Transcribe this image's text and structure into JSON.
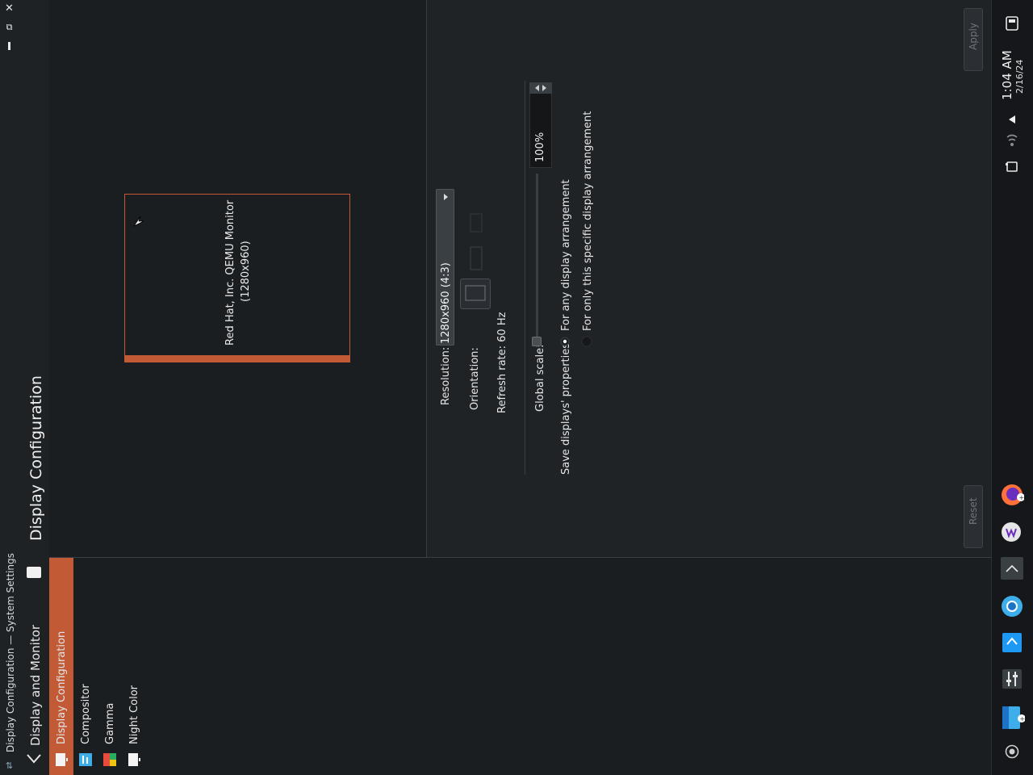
{
  "window": {
    "title": "Display Configuration — System Settings",
    "close_glyph": "✕",
    "restore_glyph": "⧉",
    "minimize_glyph": "▁"
  },
  "sidebar": {
    "back_label": "Display and Monitor",
    "items": [
      {
        "label": "Display Configuration",
        "selected": true,
        "icon": "display-icon"
      },
      {
        "label": "Compositor",
        "selected": false,
        "icon": "compositor-icon"
      },
      {
        "label": "Gamma",
        "selected": false,
        "icon": "gamma-icon"
      },
      {
        "label": "Night Color",
        "selected": false,
        "icon": "night-color-icon"
      }
    ]
  },
  "page": {
    "title": "Display Configuration"
  },
  "monitor": {
    "name": "Red Hat, Inc. QEMU Monitor",
    "resolution_text": "(1280x960)"
  },
  "settings": {
    "resolution_label": "Resolution:",
    "resolution_value": "1280x960 (4:3)",
    "orientation_label": "Orientation:",
    "refresh_label": "Refresh rate: 60 Hz",
    "scale_label": "Global scale:",
    "scale_value": "100%",
    "scale_level_percent": 0,
    "save_label": "Save displays' properties:",
    "save_options": [
      {
        "label": "For any display arrangement",
        "checked": true
      },
      {
        "label": "For only this specific display arrangement",
        "checked": false
      }
    ]
  },
  "buttons": {
    "apply": "Apply",
    "reset": "Reset"
  },
  "clock": {
    "time": "1:04 AM",
    "date": "2/16/24"
  },
  "colors": {
    "accent": "#c25a35",
    "background": "#1b1e21",
    "panel": "#202326"
  }
}
